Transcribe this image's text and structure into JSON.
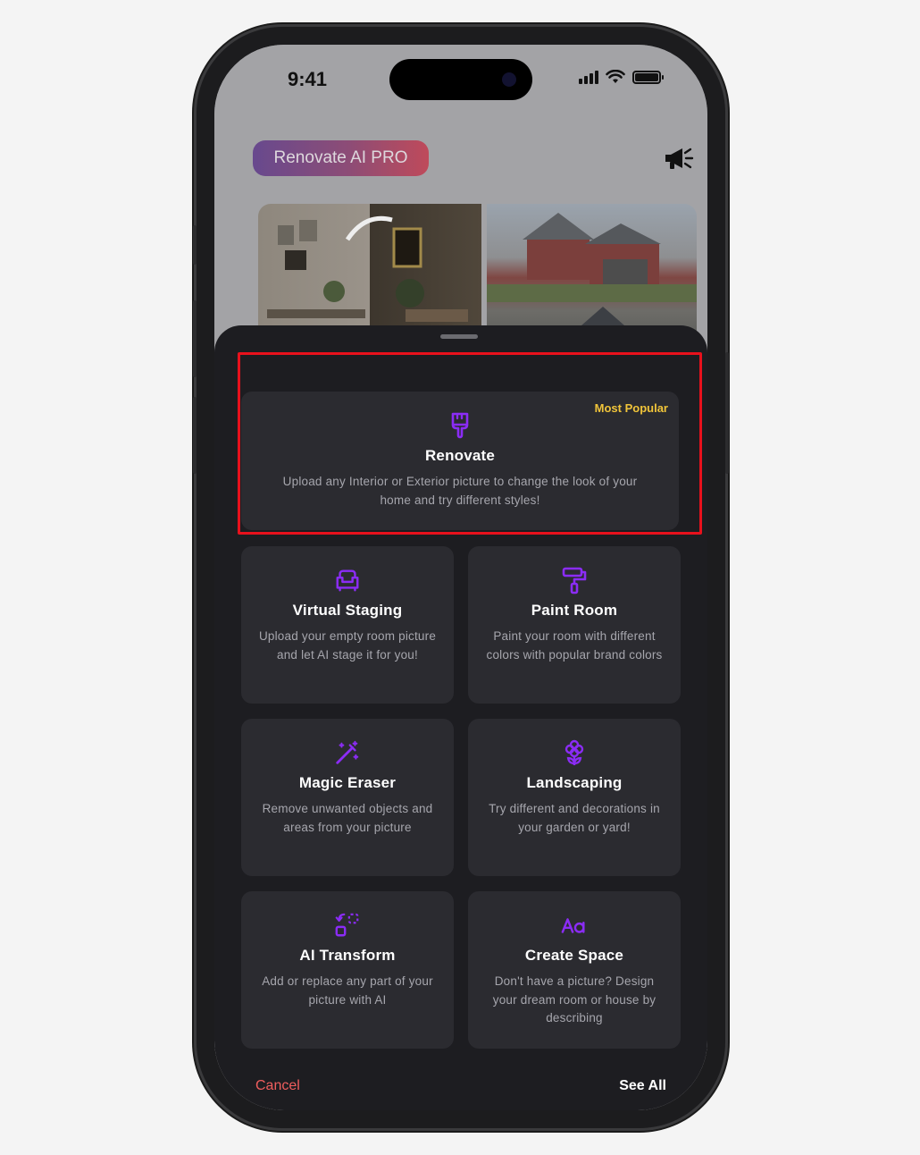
{
  "status_bar": {
    "time": "9:41"
  },
  "header": {
    "pro_label": "Renovate AI PRO",
    "announce_icon": "megaphone-icon"
  },
  "sheet": {
    "featured": {
      "badge": "Most Popular",
      "icon": "paintbrush-icon",
      "title": "Renovate",
      "description": "Upload any Interior or Exterior picture to change the look of your home and try different styles!"
    },
    "cards": [
      {
        "id": "virtual-staging",
        "icon": "sofa-icon",
        "title": "Virtual Staging",
        "description": "Upload your empty room picture and let AI stage it for you!"
      },
      {
        "id": "paint-room",
        "icon": "paint-roller-icon",
        "title": "Paint Room",
        "description": "Paint your room with different colors with popular brand colors"
      },
      {
        "id": "magic-eraser",
        "icon": "magic-wand-icon",
        "title": "Magic Eraser",
        "description": "Remove unwanted objects and areas from your picture"
      },
      {
        "id": "landscaping",
        "icon": "flower-icon",
        "title": "Landscaping",
        "description": "Try different and decorations in your garden or yard!"
      },
      {
        "id": "ai-transform",
        "icon": "transform-icon",
        "title": "AI Transform",
        "description": "Add or replace any part of your picture with AI"
      },
      {
        "id": "create-space",
        "icon": "text-aa-icon",
        "title": "Create Space",
        "description": "Don't have a picture? Design your dream room or house by describing"
      }
    ],
    "cancel_label": "Cancel",
    "see_all_label": "See All"
  },
  "colors": {
    "accent": "#8b2cf5",
    "badge": "#f0c43a",
    "cancel": "#f05e5e",
    "highlight": "#e8111c"
  }
}
